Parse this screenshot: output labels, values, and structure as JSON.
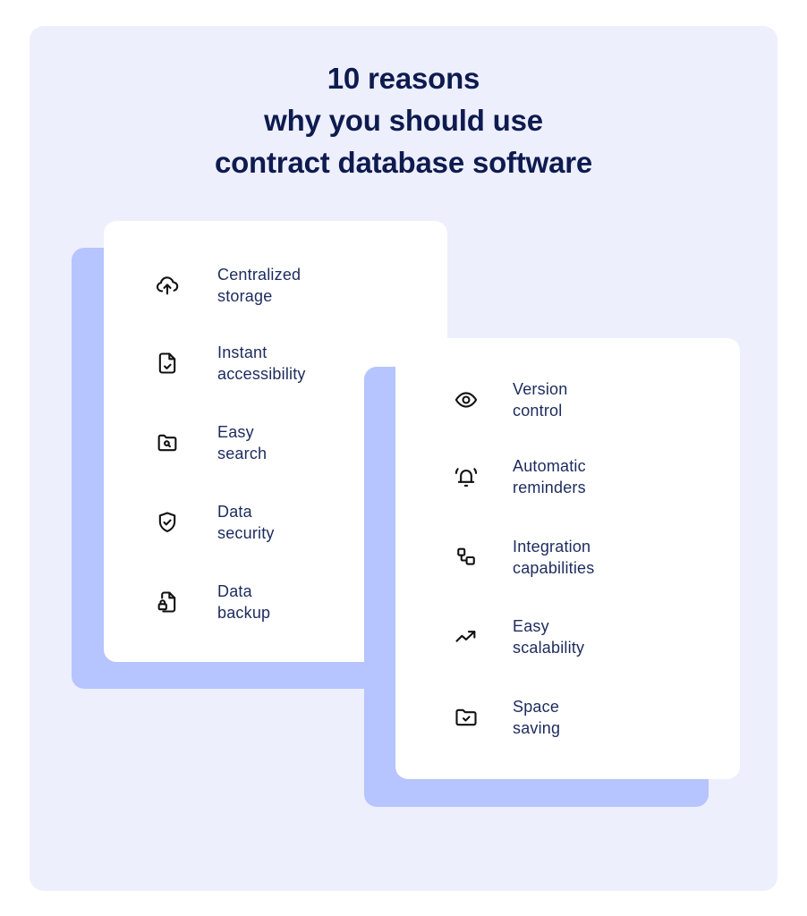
{
  "title": {
    "lines": [
      "10 reasons",
      "why you should use",
      "contract database software"
    ]
  },
  "colors": {
    "background_panel": "#eeeffd",
    "card": "#ffffff",
    "card_shadow": "#b6c4ff",
    "title_text": "#0d1b4f",
    "item_text": "#1c2b5e",
    "icon_stroke": "#111111"
  },
  "left_card": {
    "items": [
      {
        "icon": "cloud-upload-icon",
        "line1": "Centralized",
        "line2": "storage"
      },
      {
        "icon": "file-check-icon",
        "line1": "Instant",
        "line2": "accessibility"
      },
      {
        "icon": "folder-search-icon",
        "line1": "Easy",
        "line2": "search"
      },
      {
        "icon": "shield-check-icon",
        "line1": "Data",
        "line2": "security"
      },
      {
        "icon": "file-lock-icon",
        "line1": "Data",
        "line2": "backup"
      }
    ]
  },
  "right_card": {
    "items": [
      {
        "icon": "eye-icon",
        "line1": "Version",
        "line2": "control"
      },
      {
        "icon": "bell-ringing-icon",
        "line1": "Automatic",
        "line2": "reminders"
      },
      {
        "icon": "workflow-icon",
        "line1": "Integration",
        "line2": "capabilities"
      },
      {
        "icon": "trending-up-icon",
        "line1": "Easy",
        "line2": "scalability"
      },
      {
        "icon": "folder-check-icon",
        "line1": "Space",
        "line2": "saving"
      }
    ]
  }
}
